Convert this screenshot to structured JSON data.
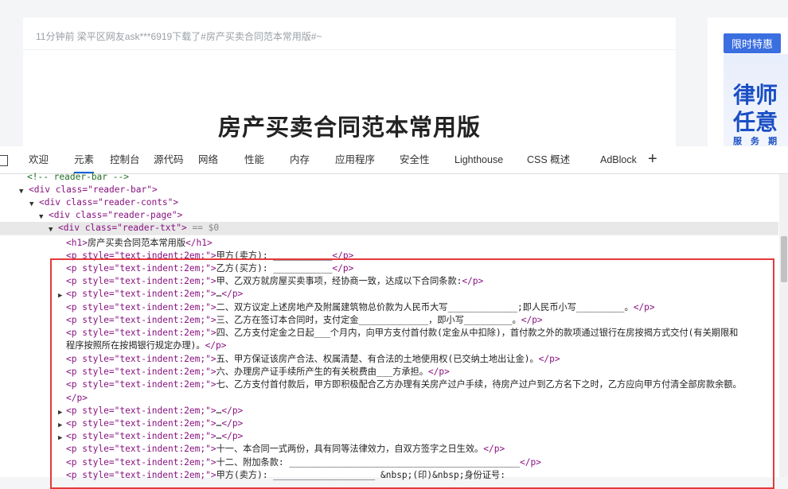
{
  "page": {
    "notice": "11分钟前 梁平区网友ask***6919下载了#房产买卖合同范本常用版#~",
    "doc_title": "房产买卖合同范本常用版",
    "side_tag": "限时特惠",
    "side_line1": "律师",
    "side_line2": "任意",
    "side_line3": "服 务 期"
  },
  "devtools": {
    "tabs": [
      "欢迎",
      "元素",
      "控制台",
      "源代码",
      "网络",
      "性能",
      "内存",
      "应用程序",
      "安全性",
      "Lighthouse",
      "CSS 概述",
      "AdBlock"
    ],
    "active_tab": "元素",
    "selected_marker": "== $0"
  },
  "tree": {
    "comment": "<!-- reader-bar -->",
    "div1": "div class=\"reader-bar\"",
    "div2": "div class=\"reader-conts\"",
    "div3": "div class=\"reader-page\"",
    "div4": "div class=\"reader-txt\""
  },
  "lines": [
    {
      "open": "<h1>",
      "text": "房产买卖合同范本常用版",
      "close": "</h1>"
    },
    {
      "open": "<p style=\"text-indent:2em;\">",
      "text": "甲方(卖方): ___________",
      "close": "</p>"
    },
    {
      "open": "<p style=\"text-indent:2em;\">",
      "text": "乙方(买方): ___________",
      "close": "</p>"
    },
    {
      "open": "<p style=\"text-indent:2em;\">",
      "text": "甲、乙双方就房屋买卖事项，经协商一致，达成以下合同条款:",
      "close": "</p>"
    },
    {
      "open": "<p style=\"text-indent:2em;\">",
      "text": "…",
      "close": "</p>"
    },
    {
      "open": "<p style=\"text-indent:2em;\">",
      "text": "二、双方议定上述房地产及附属建筑物总价款为人民币大写_____________;即人民币小写_________。",
      "close": "</p>"
    },
    {
      "open": "<p style=\"text-indent:2em;\">",
      "text": "三、乙方在签订本合同时，支付定金_____________，即小写_________。",
      "close": "</p>"
    },
    {
      "open": "<p style=\"text-indent:2em;\">",
      "text": "四、乙方支付定金之日起___个月内，向甲方支付首付款(定金从中扣除)，首付款之外的款项通过银行在房按揭方式交付(有关期限和",
      "close": ""
    },
    {
      "open": "",
      "text": "程序按照所在按揭银行规定办理)。",
      "close": "</p>"
    },
    {
      "open": "<p style=\"text-indent:2em;\">",
      "text": "五、甲方保证该房产合法、权属清楚、有合法的土地使用权(已交纳土地出让金)。",
      "close": "</p>"
    },
    {
      "open": "<p style=\"text-indent:2em;\">",
      "text": "六、办理房产证手续所产生的有关税费由___方承担。",
      "close": "</p>"
    },
    {
      "open": "<p style=\"text-indent:2em;\">",
      "text": "七、乙方支付首付款后，甲方即积极配合乙方办理有关房产过户手续，待房产过户到乙方名下之时，乙方应向甲方付清全部房款余额。",
      "close": ""
    },
    {
      "open": "",
      "text": "",
      "close": "</p>"
    },
    {
      "open": "<p style=\"text-indent:2em;\">",
      "text": "…",
      "close": "</p>"
    },
    {
      "open": "<p style=\"text-indent:2em;\">",
      "text": "…",
      "close": "</p>"
    },
    {
      "open": "<p style=\"text-indent:2em;\">",
      "text": "…",
      "close": "</p>"
    },
    {
      "open": "<p style=\"text-indent:2em;\">",
      "text": "十一、本合同一式两份，具有同等法律效力，自双方签字之日生效。",
      "close": "</p>"
    },
    {
      "open": "<p style=\"text-indent:2em;\">",
      "text": "十二、附加条款: ___________________________________________",
      "close": "</p>"
    },
    {
      "open": "<p style=\"text-indent:2em;\">",
      "text": "甲方(卖方): ___________________ &nbsp;(印)&nbsp;身份证号:",
      "close": ""
    }
  ]
}
